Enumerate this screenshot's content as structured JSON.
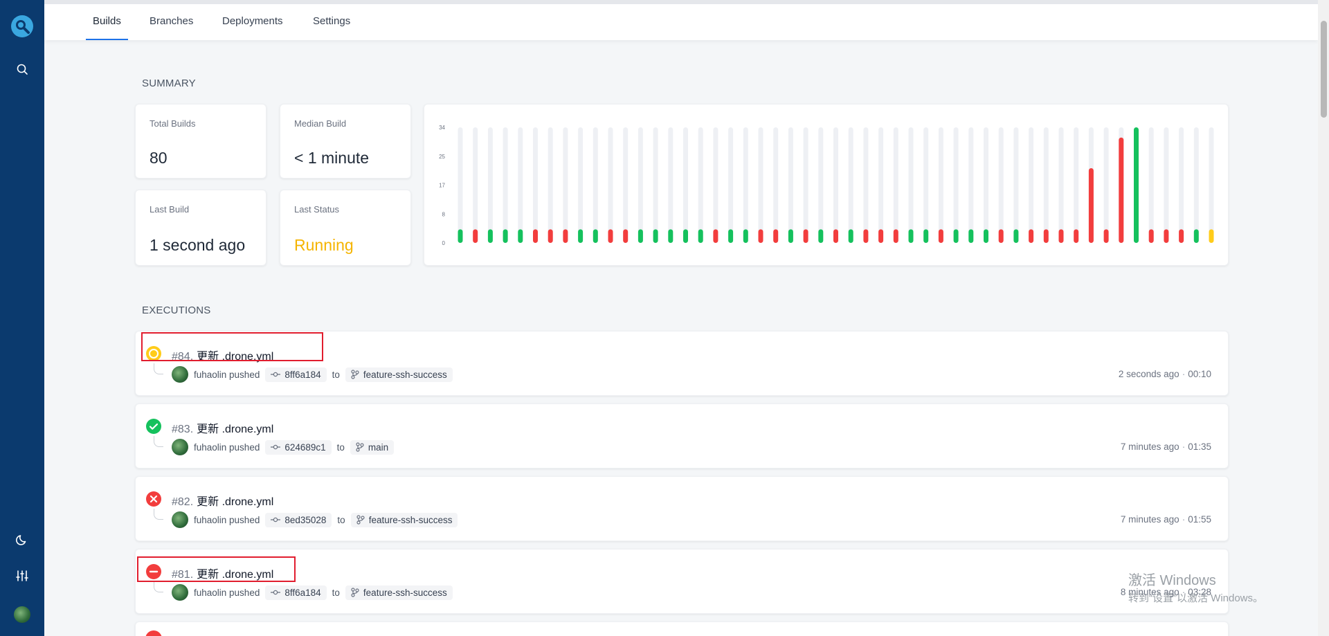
{
  "sidebar": {
    "items": [
      {
        "name": "logo"
      },
      {
        "name": "search"
      },
      {
        "name": "theme-toggle"
      },
      {
        "name": "settings"
      },
      {
        "name": "user"
      }
    ]
  },
  "tabs": [
    "Builds",
    "Branches",
    "Deployments",
    "Settings"
  ],
  "summary": {
    "title": "SUMMARY",
    "stats": [
      {
        "label": "Total Builds",
        "value": "80"
      },
      {
        "label": "Median Build",
        "value": "< 1 minute"
      },
      {
        "label": "Last Build",
        "value": "1 second ago"
      },
      {
        "label": "Last Status",
        "value": "Running"
      }
    ]
  },
  "chart_data": {
    "type": "bar",
    "yticks": [
      "34",
      "25",
      "17",
      "8",
      "0"
    ],
    "ylim": [
      0,
      34
    ],
    "colors": {
      "success": "#15c15d",
      "failure": "#f23d3d",
      "running": "#ffcc1a",
      "track": "#eef0f4"
    },
    "bars": [
      {
        "value": 4,
        "status": "success"
      },
      {
        "value": 4,
        "status": "failure"
      },
      {
        "value": 4,
        "status": "success"
      },
      {
        "value": 4,
        "status": "success"
      },
      {
        "value": 4,
        "status": "success"
      },
      {
        "value": 4,
        "status": "failure"
      },
      {
        "value": 4,
        "status": "failure"
      },
      {
        "value": 4,
        "status": "failure"
      },
      {
        "value": 4,
        "status": "success"
      },
      {
        "value": 4,
        "status": "success"
      },
      {
        "value": 4,
        "status": "failure"
      },
      {
        "value": 4,
        "status": "failure"
      },
      {
        "value": 4,
        "status": "success"
      },
      {
        "value": 4,
        "status": "success"
      },
      {
        "value": 4,
        "status": "success"
      },
      {
        "value": 4,
        "status": "success"
      },
      {
        "value": 4,
        "status": "success"
      },
      {
        "value": 4,
        "status": "failure"
      },
      {
        "value": 4,
        "status": "success"
      },
      {
        "value": 4,
        "status": "success"
      },
      {
        "value": 4,
        "status": "failure"
      },
      {
        "value": 4,
        "status": "failure"
      },
      {
        "value": 4,
        "status": "success"
      },
      {
        "value": 4,
        "status": "failure"
      },
      {
        "value": 4,
        "status": "success"
      },
      {
        "value": 4,
        "status": "failure"
      },
      {
        "value": 4,
        "status": "success"
      },
      {
        "value": 4,
        "status": "failure"
      },
      {
        "value": 4,
        "status": "failure"
      },
      {
        "value": 4,
        "status": "failure"
      },
      {
        "value": 4,
        "status": "success"
      },
      {
        "value": 4,
        "status": "success"
      },
      {
        "value": 4,
        "status": "failure"
      },
      {
        "value": 4,
        "status": "success"
      },
      {
        "value": 4,
        "status": "success"
      },
      {
        "value": 4,
        "status": "success"
      },
      {
        "value": 4,
        "status": "failure"
      },
      {
        "value": 4,
        "status": "success"
      },
      {
        "value": 4,
        "status": "failure"
      },
      {
        "value": 4,
        "status": "failure"
      },
      {
        "value": 4,
        "status": "failure"
      },
      {
        "value": 4,
        "status": "failure"
      },
      {
        "value": 22,
        "status": "failure"
      },
      {
        "value": 4,
        "status": "failure"
      },
      {
        "value": 31,
        "status": "failure"
      },
      {
        "value": 34,
        "status": "success"
      },
      {
        "value": 4,
        "status": "failure"
      },
      {
        "value": 4,
        "status": "failure"
      },
      {
        "value": 4,
        "status": "failure"
      },
      {
        "value": 4,
        "status": "success"
      },
      {
        "value": 4,
        "status": "running"
      }
    ]
  },
  "executions": {
    "title": "EXECUTIONS",
    "items": [
      {
        "num": "#84.",
        "title": "更新 .drone.yml",
        "status": "running",
        "author": "fuhaolin pushed",
        "commit": "8ff6a184",
        "to": "to",
        "branch": "feature-ssh-success",
        "ago": "2 seconds ago",
        "duration": "00:10"
      },
      {
        "num": "#83.",
        "title": "更新 .drone.yml",
        "status": "success",
        "author": "fuhaolin pushed",
        "commit": "624689c1",
        "to": "to",
        "branch": "main",
        "ago": "7 minutes ago",
        "duration": "01:35"
      },
      {
        "num": "#82.",
        "title": "更新 .drone.yml",
        "status": "failure",
        "author": "fuhaolin pushed",
        "commit": "8ed35028",
        "to": "to",
        "branch": "feature-ssh-success",
        "ago": "7 minutes ago",
        "duration": "01:55"
      },
      {
        "num": "#81.",
        "title": "更新 .drone.yml",
        "status": "killed",
        "author": "fuhaolin pushed",
        "commit": "8ff6a184",
        "to": "to",
        "branch": "feature-ssh-success",
        "ago": "8 minutes ago",
        "duration": "03:28"
      }
    ]
  },
  "watermark": {
    "line1": "激活 Windows",
    "line2": "转到“设置”以激活 Windows。"
  }
}
